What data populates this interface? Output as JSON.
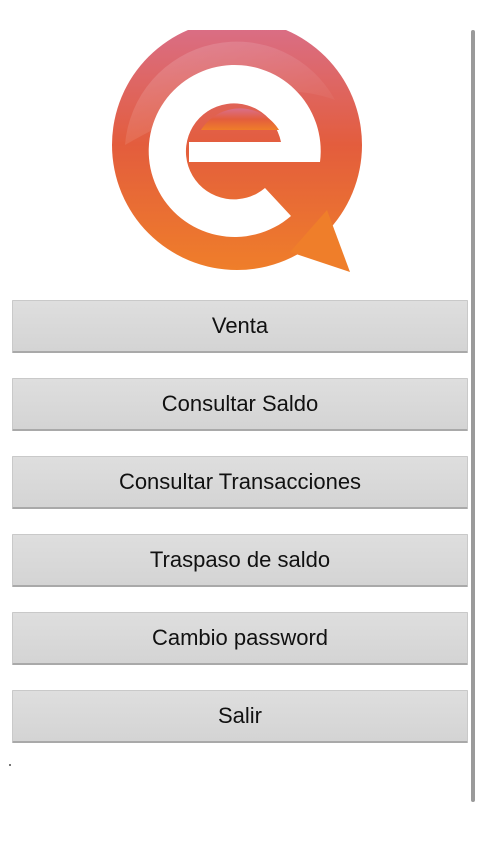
{
  "app": {
    "logo_icon": "chat-bubble-e-logo-icon",
    "brand_colors": {
      "top": "#d96f8a",
      "middle": "#e35d3d",
      "bottom": "#ef7e2a"
    }
  },
  "menu": {
    "items": [
      {
        "label": "Venta"
      },
      {
        "label": "Consultar Saldo"
      },
      {
        "label": "Consultar Transacciones"
      },
      {
        "label": "Traspaso de saldo"
      },
      {
        "label": "Cambio password"
      },
      {
        "label": "Salir"
      }
    ]
  }
}
